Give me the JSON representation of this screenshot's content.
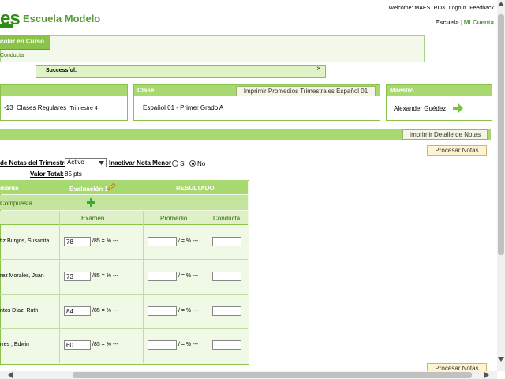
{
  "header": {
    "logo_text": "es",
    "site_title": "Escuela Modelo",
    "welcome": "Welcome: MAESTRO3",
    "logout": "Logout",
    "feedback": "Feedback",
    "nav_current": "Escuela",
    "nav_separator": "|",
    "nav_account": "Mi Cuenta"
  },
  "tabs": {
    "active_label": "colar en Curso",
    "sub_item": "Conducta"
  },
  "message": {
    "text": "Successful.",
    "close": "×"
  },
  "panels": {
    "left_text": "-13",
    "left_class": "Clases Regulares",
    "left_trimestre": "Trimestre 4",
    "clase_title": "Clase",
    "clase_button": "Imprimir Promedios Trimestrales Español 01",
    "clase_value": "Español 01 -  Primer Grado  A",
    "maestro_title": "Maestro",
    "maestro_value": "Alexander Guédez"
  },
  "grades": {
    "print_detail": "Imprimir Detalle de Notas",
    "process_top": "Procesar Notas",
    "process_bottom": "Procesar Notas",
    "filter_label": "de Notas del Trimestre",
    "filter_value": "Activo",
    "inactivar_label": "Inactivar Nota Menor",
    "radio_si": "Si",
    "radio_no": "No",
    "valor_total_label": "Valor Total:",
    "valor_total_value": "85 pts",
    "col_estudiante": "diante",
    "col_evaluacion": "Evaluación 1",
    "col_resultado": "RESULTADO",
    "compuesta": "Compuesta",
    "col_examen": "Examen",
    "col_promedio": "Promedio",
    "col_conducta": "Conducta",
    "students": [
      {
        "name": "tiz Burgos, Susanita",
        "exam": "78",
        "exam_suffix": "/85 = % ---",
        "prom_suffix": "/ = % ---"
      },
      {
        "name": "rez Morales, Juan",
        "exam": "73",
        "exam_suffix": "/85 = % ---",
        "prom_suffix": "/ = % ---"
      },
      {
        "name": "ntos Díaz, Ruth",
        "exam": "84",
        "exam_suffix": "/85 = % ---",
        "prom_suffix": "/ = % ---"
      },
      {
        "name": "rres , Edwin",
        "exam": "60",
        "exam_suffix": "/85 = % ---",
        "prom_suffix": "/ = % ---"
      }
    ]
  },
  "colors": {
    "accent": "#8bc34a",
    "header_green": "#a8d870",
    "text_green": "#5a9a3a"
  }
}
